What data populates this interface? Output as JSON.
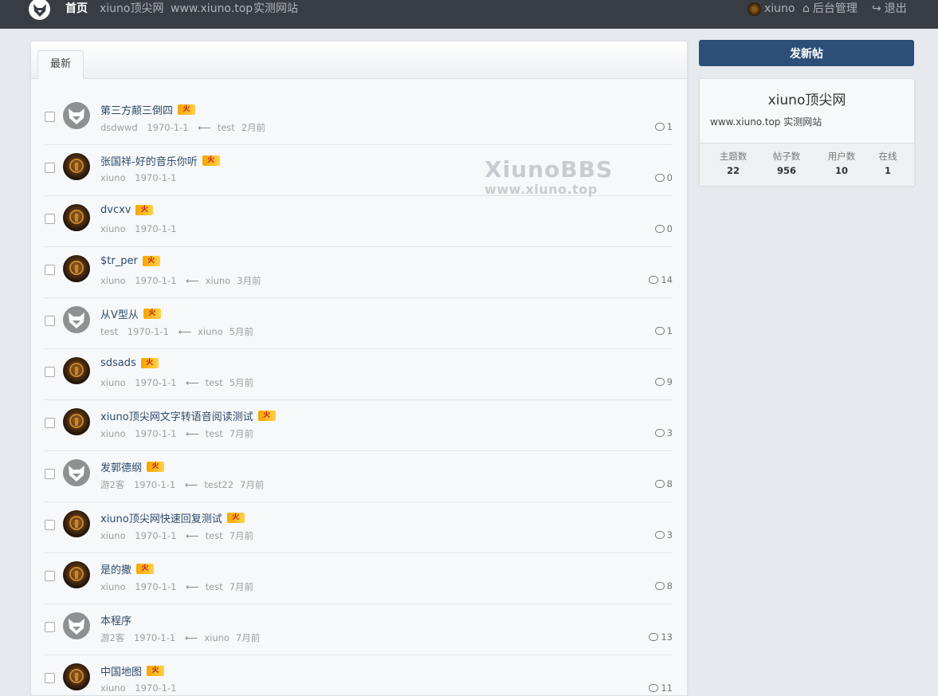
{
  "nav": {
    "links": [
      "首页",
      "xiuno顶尖网",
      "www.xiuno.top",
      "实测网站"
    ],
    "user": "xiuno",
    "admin": "后台管理",
    "logout": "退出"
  },
  "tab": "最新",
  "threads": [
    {
      "subject": "第三方颠三倒四",
      "author": "dsdwwd",
      "date": "1970-1-1",
      "last_user": "test",
      "last_time": "2月前",
      "replies": "1",
      "avatar": "gray"
    },
    {
      "subject": "张国祥-好的音乐你听",
      "author": "xiuno",
      "date": "1970-1-1",
      "last_user": "",
      "last_time": "",
      "replies": "0",
      "avatar": "dark"
    },
    {
      "subject": "dvcxv",
      "author": "xiuno",
      "date": "1970-1-1",
      "last_user": "",
      "last_time": "",
      "replies": "0",
      "avatar": "dark"
    },
    {
      "subject": "$tr_per",
      "author": "xiuno",
      "date": "1970-1-1",
      "last_user": "xiuno",
      "last_time": "3月前",
      "replies": "14",
      "avatar": "dark"
    },
    {
      "subject": "从V型从",
      "author": "test",
      "date": "1970-1-1",
      "last_user": "xiuno",
      "last_time": "5月前",
      "replies": "1",
      "avatar": "gray"
    },
    {
      "subject": "sdsads",
      "author": "xiuno",
      "date": "1970-1-1",
      "last_user": "test",
      "last_time": "5月前",
      "replies": "9",
      "avatar": "dark"
    },
    {
      "subject": "xiuno顶尖网文字转语音阅读测试",
      "author": "xiuno",
      "date": "1970-1-1",
      "last_user": "test",
      "last_time": "7月前",
      "replies": "3",
      "avatar": "dark"
    },
    {
      "subject": "发郭德纲",
      "author": "游2客",
      "date": "1970-1-1",
      "last_user": "test22",
      "last_time": "7月前",
      "replies": "8",
      "avatar": "gray"
    },
    {
      "subject": "xiuno顶尖网快速回复测试",
      "author": "xiuno",
      "date": "1970-1-1",
      "last_user": "test",
      "last_time": "7月前",
      "replies": "3",
      "avatar": "dark"
    },
    {
      "subject": "是的撒",
      "author": "xiuno",
      "date": "1970-1-1",
      "last_user": "test",
      "last_time": "7月前",
      "replies": "8",
      "avatar": "dark"
    },
    {
      "subject": "本程序",
      "author": "游2客",
      "date": "1970-1-1",
      "last_user": "xiuno",
      "last_time": "7月前",
      "replies": "13",
      "avatar": "gray",
      "hot": false
    },
    {
      "subject": "中国地图",
      "author": "xiuno",
      "date": "1970-1-1",
      "last_user": "",
      "last_time": "",
      "replies": "11",
      "avatar": "dark"
    }
  ],
  "hot_label": "火",
  "watermark": {
    "line1": "XiunoBBS",
    "line2": "www.xiuno.top"
  },
  "sidebar": {
    "new_post": "发新帖",
    "site_name": "xiuno顶尖网",
    "site_desc": "www.xiuno.top 实测网站",
    "stats": [
      {
        "label": "主题数",
        "value": "22"
      },
      {
        "label": "帖子数",
        "value": "956"
      },
      {
        "label": "用户数",
        "value": "10"
      },
      {
        "label": "在线",
        "value": "1"
      }
    ]
  },
  "colors": {
    "navbar": "#383d44",
    "primary_button": "#2c4e78"
  }
}
